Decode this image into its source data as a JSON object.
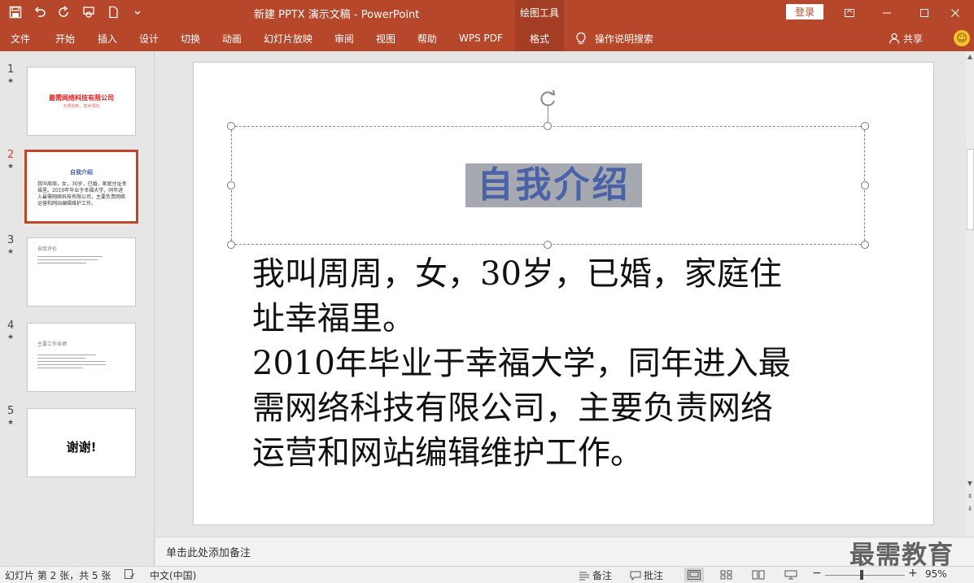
{
  "titlebar": {
    "doc_title": "新建 PPTX 演示文稿  -  PowerPoint",
    "context_tab_title": "绘图工具",
    "login_label": "登录"
  },
  "ribbon": {
    "tabs": [
      {
        "label": "文件"
      },
      {
        "label": "开始"
      },
      {
        "label": "插入"
      },
      {
        "label": "设计"
      },
      {
        "label": "切换"
      },
      {
        "label": "动画"
      },
      {
        "label": "幻灯片放映"
      },
      {
        "label": "审阅"
      },
      {
        "label": "视图"
      },
      {
        "label": "帮助"
      },
      {
        "label": "WPS PDF"
      },
      {
        "label": "格式"
      }
    ],
    "active_tab": "格式",
    "tell_me": "操作说明搜索",
    "share": "共享"
  },
  "thumbnails": [
    {
      "num": "1",
      "title": "最需网络科技有限公司",
      "subtitle": "无限创新，技术领先"
    },
    {
      "num": "2",
      "title": "自我介绍",
      "body": "我叫周周，女，30岁，已婚，家庭住址幸福里。2010年毕业于幸福大学，同年进入最需网络科技有限公司，主要负责网络运营和网站编辑维护工作。"
    },
    {
      "num": "3",
      "title": "自我评价"
    },
    {
      "num": "4",
      "title": "主要工作业绩"
    },
    {
      "num": "5",
      "title": "谢谢!"
    }
  ],
  "slide": {
    "title": "自我介绍",
    "body_lines": [
      "我叫周周，女，30岁，已婚，家庭住",
      "址幸福里。",
      "2010年毕业于幸福大学，同年进入最",
      "需网络科技有限公司，主要负责网络",
      "运营和网站编辑维护工作。"
    ]
  },
  "notes": {
    "placeholder": "单击此处添加备注"
  },
  "watermark": "最需教育",
  "statusbar": {
    "slide_info": "幻灯片 第 2 张，共 5 张",
    "language": "中文(中国)",
    "notes_label": "备注",
    "comments_label": "批注",
    "zoom": "95%"
  },
  "colors": {
    "accent": "#b7472a",
    "title_text": "#4a62a8"
  }
}
